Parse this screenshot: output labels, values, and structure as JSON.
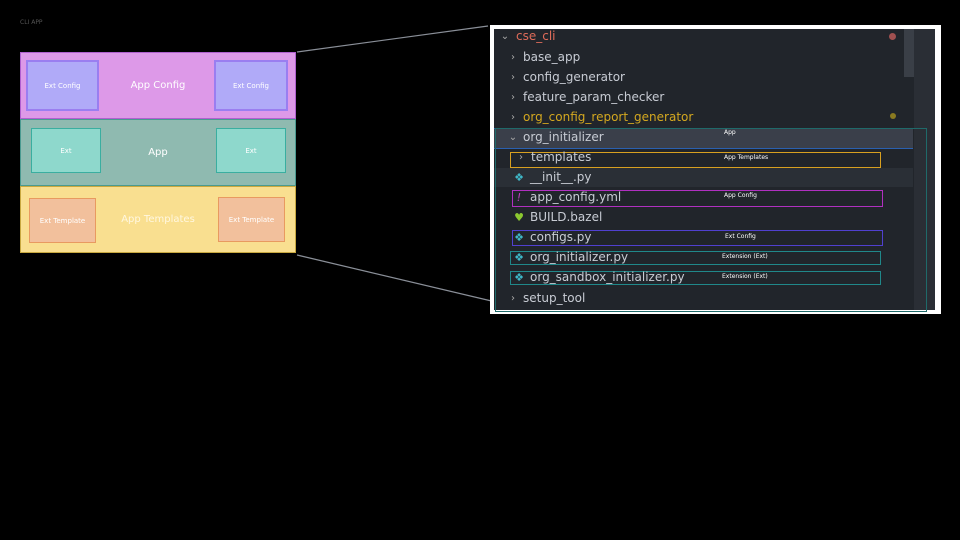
{
  "title": "CLI APP",
  "diagram": {
    "app_config": {
      "label": "App Config",
      "left": "Ext Config",
      "right": "Ext Config",
      "color": "#dd99e8"
    },
    "app": {
      "label": "App",
      "left": "Ext",
      "right": "Ext",
      "color": "#8fbab0"
    },
    "app_templates": {
      "label": "App Templates",
      "left": "Ext Template",
      "right": "Ext Template",
      "color": "#f9df90"
    }
  },
  "tree": {
    "root": "cse_cli",
    "items": [
      {
        "name": "base_app",
        "type": "folder"
      },
      {
        "name": "config_generator",
        "type": "folder"
      },
      {
        "name": "feature_param_checker",
        "type": "folder"
      },
      {
        "name": "org_config_report_generator",
        "type": "folder"
      },
      {
        "name": "org_initializer",
        "type": "folder-open",
        "annotation": "App"
      },
      {
        "name": "templates",
        "type": "folder",
        "annotation": "App Templates"
      },
      {
        "name": "__init__.py",
        "type": "python"
      },
      {
        "name": "app_config.yml",
        "type": "yaml",
        "annotation": "App Config"
      },
      {
        "name": "BUILD.bazel",
        "type": "bazel"
      },
      {
        "name": "configs.py",
        "type": "python",
        "annotation": "Ext Config"
      },
      {
        "name": "org_initializer.py",
        "type": "python",
        "annotation": "Extension (Ext)"
      },
      {
        "name": "org_sandbox_initializer.py",
        "type": "python",
        "annotation": "Extension (Ext)"
      },
      {
        "name": "setup_tool",
        "type": "folder"
      }
    ]
  }
}
